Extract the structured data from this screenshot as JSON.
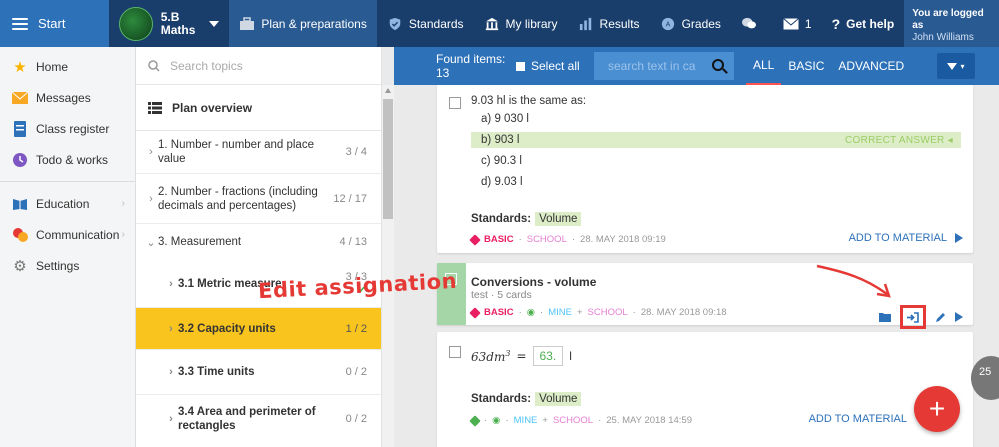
{
  "topbar": {
    "start_label": "Start",
    "class_name": "5.B",
    "subject": "Maths",
    "items": [
      {
        "label": "Plan & preparations"
      },
      {
        "label": "Standards"
      },
      {
        "label": "My library"
      },
      {
        "label": "Results"
      },
      {
        "label": "Grades"
      },
      {
        "label": ""
      },
      {
        "label": "1"
      },
      {
        "label": "Get help"
      }
    ],
    "logged_title": "You are logged as",
    "logged_user": "John Williams"
  },
  "sidebar": {
    "items": [
      {
        "label": "Home"
      },
      {
        "label": "Messages"
      },
      {
        "label": "Class register"
      },
      {
        "label": "Todo & works"
      },
      {
        "label": "Education"
      },
      {
        "label": "Communication"
      },
      {
        "label": "Settings"
      }
    ]
  },
  "topics": {
    "search_placeholder": "Search topics",
    "plan_overview": "Plan overview",
    "rows": [
      {
        "label": "1. Number - number and place value",
        "count": "3 / 4"
      },
      {
        "label": "2. Number - fractions (including decimals and percentages)",
        "count": "12 / 17"
      },
      {
        "label": "3. Measurement",
        "count": "4 / 13"
      },
      {
        "label": "3.1  Metric measure",
        "count": "3 / 3"
      },
      {
        "label": "3.2  Capacity units",
        "count": "1 / 2"
      },
      {
        "label": "3.3  Time units",
        "count": "0 / 2"
      },
      {
        "label": "3.4  Area and perimeter of rectangles",
        "count": "0 / 2"
      }
    ]
  },
  "results": {
    "found": "Found items: 13",
    "select_all": "Select all",
    "search_placeholder": "search text in ca",
    "filters": [
      "ALL",
      "BASIC",
      "ADVANCED"
    ]
  },
  "card1": {
    "question": "9.03 hl is the same as:",
    "options": [
      {
        "letter": "a)",
        "text": "9 030 l"
      },
      {
        "letter": "b)",
        "text": "903 l"
      },
      {
        "letter": "c)",
        "text": "90.3 l"
      },
      {
        "letter": "d)",
        "text": "9.03 l"
      }
    ],
    "correct_label": "CORRECT ANSWER",
    "standards_label": "Standards:",
    "standard": "Volume",
    "level": "BASIC",
    "source": "SCHOOL",
    "date": "28. MAY 2018 09:19",
    "add": "ADD TO MATERIAL"
  },
  "card2": {
    "title": "Conversions - volume",
    "subtitle": "test · 5 cards",
    "level": "BASIC",
    "mine": "MINE",
    "school": "SCHOOL",
    "date": "28. MAY 2018 09:18"
  },
  "card3": {
    "expression": "63dm",
    "exponent": "3",
    "equals": "=",
    "answer": "63.",
    "unit": "l",
    "standards_label": "Standards:",
    "standard": "Volume",
    "mine": "MINE",
    "school": "SCHOOL",
    "date": "25. MAY 2018 14:59",
    "add": "ADD TO MATERIAL"
  },
  "annotation": "Edit assignation",
  "fab_label": "+",
  "side_badge": "25"
}
